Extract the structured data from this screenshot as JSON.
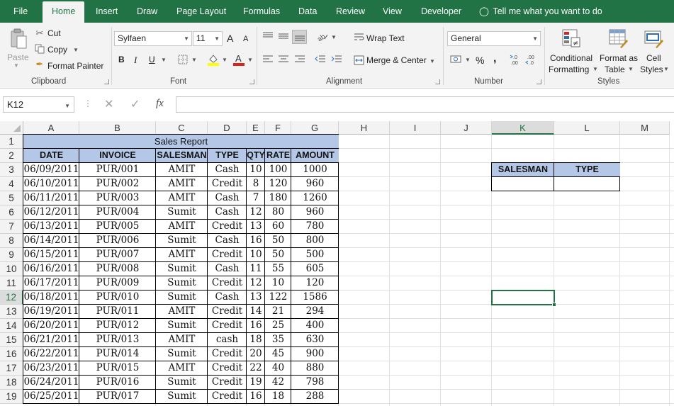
{
  "tabs": [
    "File",
    "Home",
    "Insert",
    "Draw",
    "Page Layout",
    "Formulas",
    "Data",
    "Review",
    "View",
    "Developer"
  ],
  "tell_me": "Tell me what you want to do",
  "clipboard": {
    "paste": "Paste",
    "cut": "Cut",
    "copy": "Copy",
    "format_painter": "Format Painter",
    "label": "Clipboard"
  },
  "font": {
    "name": "Sylfaen",
    "size": "11",
    "label": "Font",
    "grow": "A",
    "shrink": "A",
    "bold": "B",
    "italic": "I",
    "underline": "U"
  },
  "alignment": {
    "wrap": "Wrap Text",
    "merge": "Merge & Center",
    "label": "Alignment"
  },
  "number": {
    "format": "General",
    "percent": "%",
    "comma": ",",
    "label": "Number"
  },
  "styles": {
    "conditional": [
      "Conditional",
      "Formatting"
    ],
    "table": [
      "Format as",
      "Table"
    ],
    "cell": [
      "Cell",
      "Styles"
    ],
    "label": "Styles"
  },
  "name_box": "K12",
  "fx": "fx",
  "columns": [
    "A",
    "B",
    "C",
    "D",
    "E",
    "F",
    "G",
    "H",
    "I",
    "J",
    "K",
    "L",
    "M"
  ],
  "rows": [
    "1",
    "2",
    "3",
    "4",
    "5",
    "6",
    "7",
    "8",
    "9",
    "10",
    "11",
    "12",
    "13",
    "14",
    "15",
    "16",
    "17",
    "18",
    "19"
  ],
  "selected": {
    "column": "K",
    "row": "12"
  },
  "report": {
    "title": "Sales Report",
    "headers": [
      "DATE",
      "INVOICE",
      "SALESMAN",
      "TYPE",
      "QTY",
      "RATE",
      "AMOUNT"
    ],
    "rows": [
      [
        "06/09/2011",
        "PUR/001",
        "AMIT",
        "Cash",
        "10",
        "100",
        "1000"
      ],
      [
        "06/10/2011",
        "PUR/002",
        "AMIT",
        "Credit",
        "8",
        "120",
        "960"
      ],
      [
        "06/11/2011",
        "PUR/003",
        "AMIT",
        "Cash",
        "7",
        "180",
        "1260"
      ],
      [
        "06/12/2011",
        "PUR/004",
        "Sumit",
        "Cash",
        "12",
        "80",
        "960"
      ],
      [
        "06/13/2011",
        "PUR/005",
        "AMIT",
        "Credit",
        "13",
        "60",
        "780"
      ],
      [
        "06/14/2011",
        "PUR/006",
        "Sumit",
        "Cash",
        "16",
        "50",
        "800"
      ],
      [
        "06/15/2011",
        "PUR/007",
        "AMIT",
        "Credit",
        "10",
        "50",
        "500"
      ],
      [
        "06/16/2011",
        "PUR/008",
        "Sumit",
        "Cash",
        "11",
        "55",
        "605"
      ],
      [
        "06/17/2011",
        "PUR/009",
        "Sumit",
        "Credit",
        "12",
        "10",
        "120"
      ],
      [
        "06/18/2011",
        "PUR/010",
        "Sumit",
        "Cash",
        "13",
        "122",
        "1586"
      ],
      [
        "06/19/2011",
        "PUR/011",
        "AMIT",
        "Credit",
        "14",
        "21",
        "294"
      ],
      [
        "06/20/2011",
        "PUR/012",
        "Sumit",
        "Credit",
        "16",
        "25",
        "400"
      ],
      [
        "06/21/2011",
        "PUR/013",
        "AMIT",
        "cash",
        "18",
        "35",
        "630"
      ],
      [
        "06/22/2011",
        "PUR/014",
        "Sumit",
        "Credit",
        "20",
        "45",
        "900"
      ],
      [
        "06/23/2011",
        "PUR/015",
        "AMIT",
        "Credit",
        "22",
        "40",
        "880"
      ],
      [
        "06/24/2011",
        "PUR/016",
        "Sumit",
        "Credit",
        "19",
        "42",
        "798"
      ],
      [
        "06/25/2011",
        "PUR/017",
        "Sumit",
        "Credit",
        "16",
        "18",
        "288"
      ]
    ]
  },
  "criteria": {
    "headers": [
      "SALESMAN",
      "TYPE"
    ],
    "values": [
      "",
      ""
    ]
  },
  "colors": {
    "excel_green": "#217346",
    "header_fill": "#b4c7e7",
    "ribbon_bg": "#f3f3f3"
  }
}
